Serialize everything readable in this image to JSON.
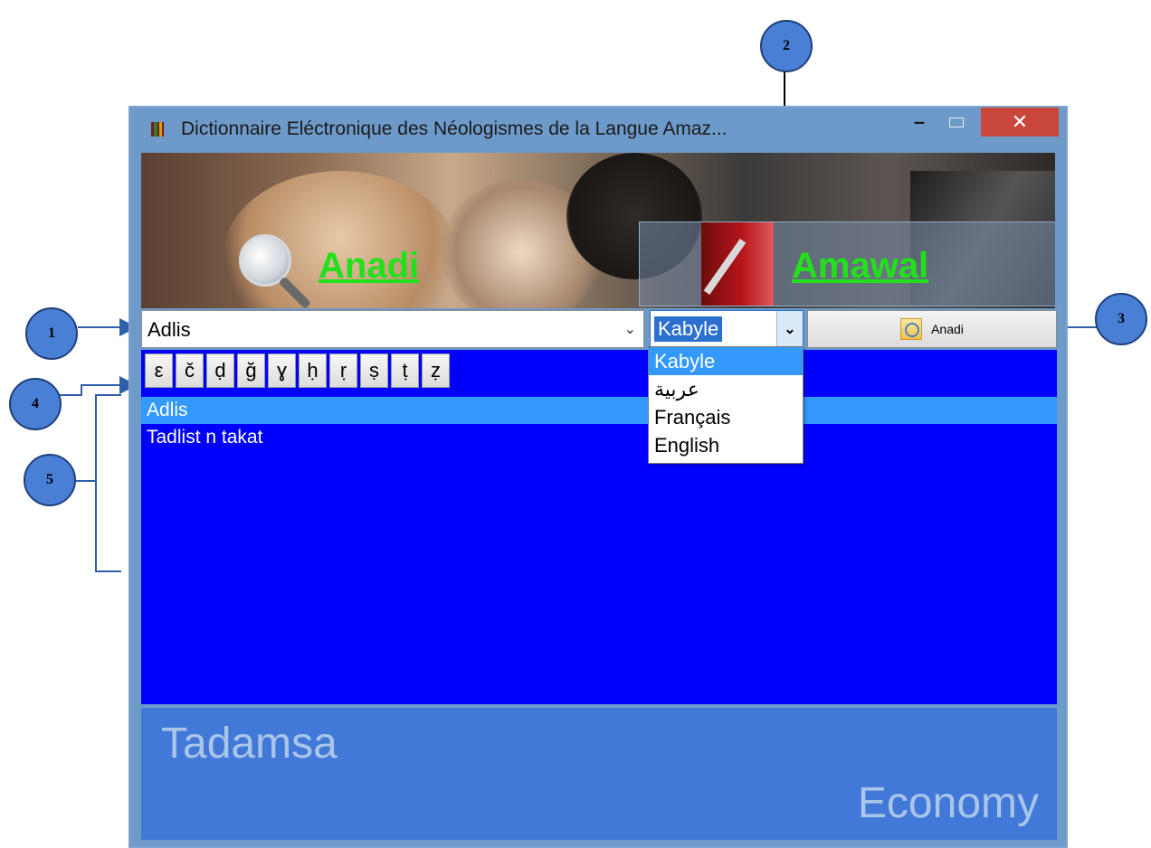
{
  "window": {
    "title": "Dictionnaire Eléctronique des Néologismes de la Langue Amaz...",
    "minimize": "–",
    "close": "✕"
  },
  "banner": {
    "anadi_label": "Anadi",
    "amawal_label": "Amawal"
  },
  "search": {
    "value": "Adlis",
    "chevron": "⌄"
  },
  "language": {
    "selected": "Kabyle",
    "arrow": "⌄",
    "options": [
      "Kabyle",
      "عربية",
      "Français",
      "English"
    ]
  },
  "search_button": {
    "label": "Anadi"
  },
  "special_chars": [
    "ε",
    "č",
    "ḍ",
    "ğ",
    "ɣ",
    "ḥ",
    "ṛ",
    "ṣ",
    "ṭ",
    "ẓ"
  ],
  "results": [
    "Adlis",
    "Tadlist n takat"
  ],
  "footer": {
    "category": "Tadamsa",
    "translation": "Economy"
  },
  "callouts": [
    "1",
    "2",
    "3",
    "4",
    "5"
  ],
  "colors": {
    "panel_blue": "#0000ff",
    "selection_blue": "#3399ff",
    "footer_blue": "#4279d8",
    "link_green": "#23e01d",
    "close_red": "#c9473a"
  }
}
